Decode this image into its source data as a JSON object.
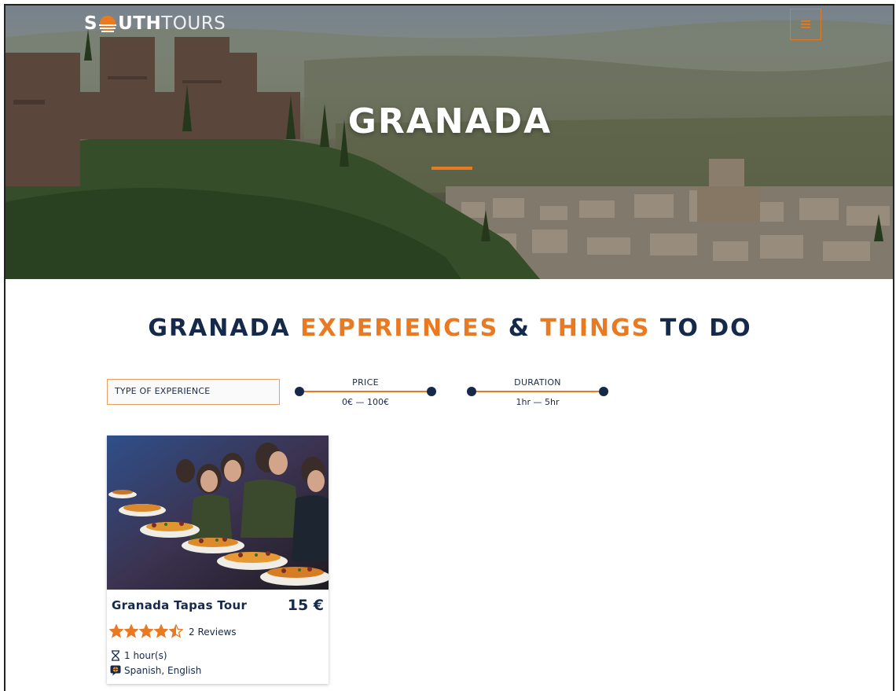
{
  "brand": {
    "logo_part1": "S",
    "logo_part2": "UTH",
    "logo_part3": "TOURS"
  },
  "header": {
    "menu_icon": "hamburger-menu-icon"
  },
  "hero": {
    "title": "GRANADA"
  },
  "section": {
    "title_part1": "GRANADA ",
    "title_part2": "EXPERIENCES",
    "title_part3": " & ",
    "title_part4": "THINGS",
    "title_part5": " TO DO"
  },
  "filters": {
    "type_label": "TYPE OF EXPERIENCE",
    "price_label": "PRICE",
    "price_value": "0€ — 100€",
    "duration_label": "DURATION",
    "duration_value": "1hr — 5hr"
  },
  "experiences": [
    {
      "title": "Granada Tapas Tour",
      "price": "15 €",
      "rating": 4.5,
      "rating_max": 5,
      "reviews": "2 Reviews",
      "duration": "1 hour(s)",
      "languages": "Spanish, English"
    }
  ],
  "colors": {
    "accent": "#ea7a22",
    "navy": "#15294a"
  }
}
